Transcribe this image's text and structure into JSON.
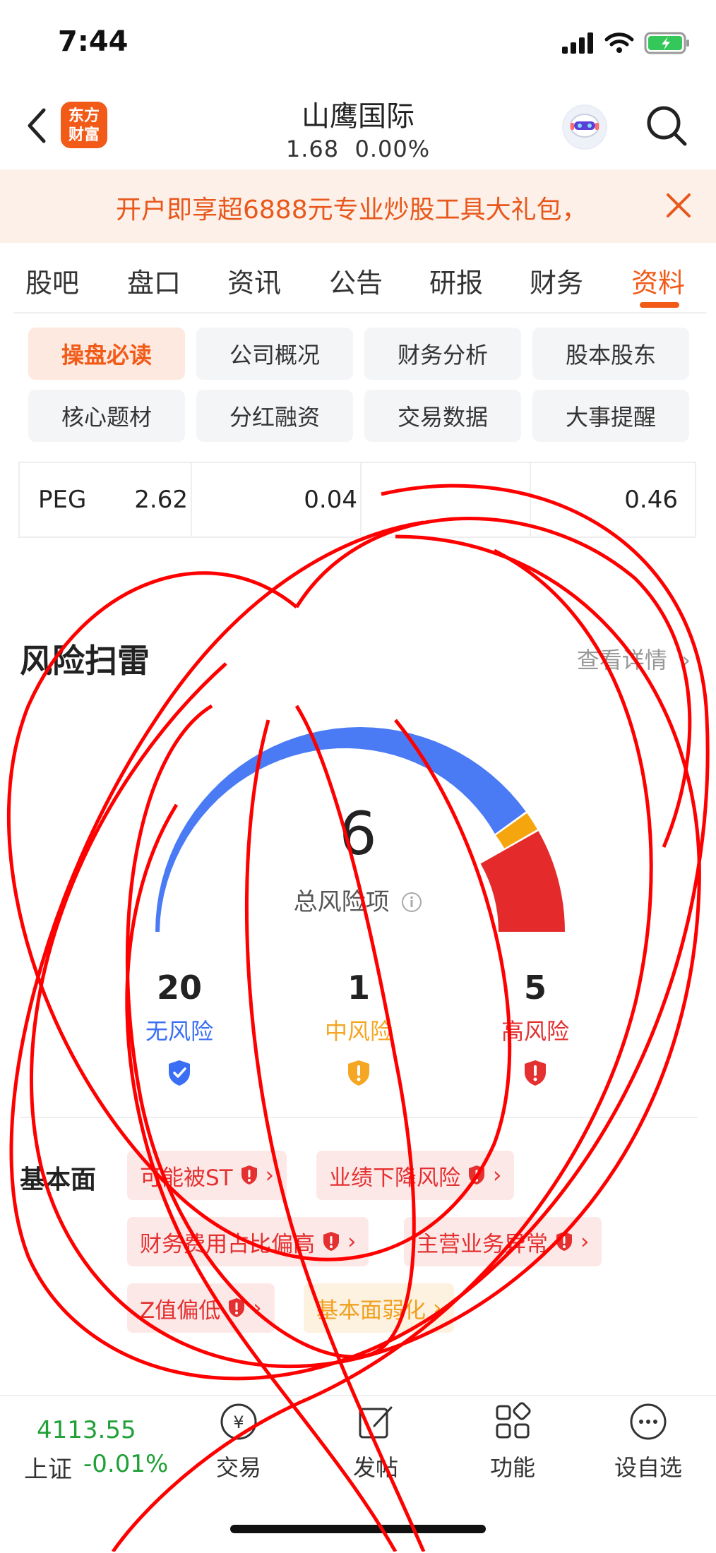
{
  "status_bar": {
    "time": "7:44"
  },
  "header": {
    "logo_text": "东方财富",
    "title": "山鹰国际",
    "price": "1.68",
    "change": "0.00%"
  },
  "banner": {
    "text": "开户即享超6888元专业炒股工具大礼包，"
  },
  "tabs": [
    "股吧",
    "盘口",
    "资讯",
    "公告",
    "研报",
    "财务",
    "资料"
  ],
  "active_tab": "资料",
  "subtabs": [
    "操盘必读",
    "公司概况",
    "财务分析",
    "股本股东",
    "核心题材",
    "分红融资",
    "交易数据",
    "大事提醒"
  ],
  "active_subtab": "操盘必读",
  "peg_row": {
    "label": "PEG",
    "values": [
      "2.62",
      "0.04",
      "0.46"
    ]
  },
  "risk_scan": {
    "title": "风险扫雷",
    "more": "查看详情",
    "total": "6",
    "total_label": "总风险项",
    "stats": [
      {
        "count": "20",
        "label": "无风险",
        "color": "#3a6ff5"
      },
      {
        "count": "1",
        "label": "中风险",
        "color": "#f5a623"
      },
      {
        "count": "5",
        "label": "高风险",
        "color": "#e43030"
      }
    ],
    "gauge": {
      "no_risk_fraction": 0.8,
      "mid_fraction": 0.033,
      "high_fraction": 0.167
    },
    "fundamentals_label": "基本面",
    "tags": [
      {
        "text": "可能被ST",
        "level": "high"
      },
      {
        "text": "业绩下降风险",
        "level": "high"
      },
      {
        "text": "财务费用占比偏高",
        "level": "high"
      },
      {
        "text": "主营业务异常",
        "level": "high"
      },
      {
        "text": "Z值偏低",
        "level": "high"
      },
      {
        "text": "基本面弱化",
        "level": "weak"
      }
    ]
  },
  "bottom_bar": {
    "index_value": "4113.55",
    "index_name": "上证",
    "index_change": "-0.01%",
    "items": [
      "交易",
      "发帖",
      "功能",
      "设自选"
    ]
  },
  "colors": {
    "accent": "#f25a18",
    "up_green": "#21a038",
    "risk_red": "#e43030",
    "risk_yellow": "#f5a623",
    "safe_blue": "#3a6ff5"
  }
}
